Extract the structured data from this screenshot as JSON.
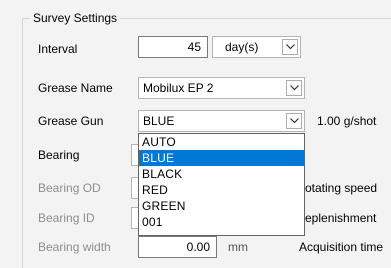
{
  "group": {
    "title": "Survey Settings"
  },
  "interval": {
    "label": "Interval",
    "value": "45",
    "unit": "day(s)"
  },
  "grease_name": {
    "label": "Grease Name",
    "value": "Mobilux EP 2"
  },
  "grease_gun": {
    "label": "Grease Gun",
    "value": "BLUE",
    "rate": "1.00 g/shot",
    "options": [
      "AUTO",
      "BLUE",
      "BLACK",
      "RED",
      "GREEN",
      "001"
    ],
    "selected_option": "BLUE"
  },
  "bearing": {
    "label": "Bearing"
  },
  "bearing_od": {
    "label": "Bearing OD",
    "right_text": "otating speed"
  },
  "bearing_id": {
    "label": "Bearing ID",
    "right_text": "eplenishment"
  },
  "bearing_width": {
    "label": "Bearing width",
    "value": "0.00",
    "unit": "mm",
    "right_text": "Acquisition time"
  },
  "icons": {
    "dropdown_arrow": "chevron-down-icon"
  }
}
